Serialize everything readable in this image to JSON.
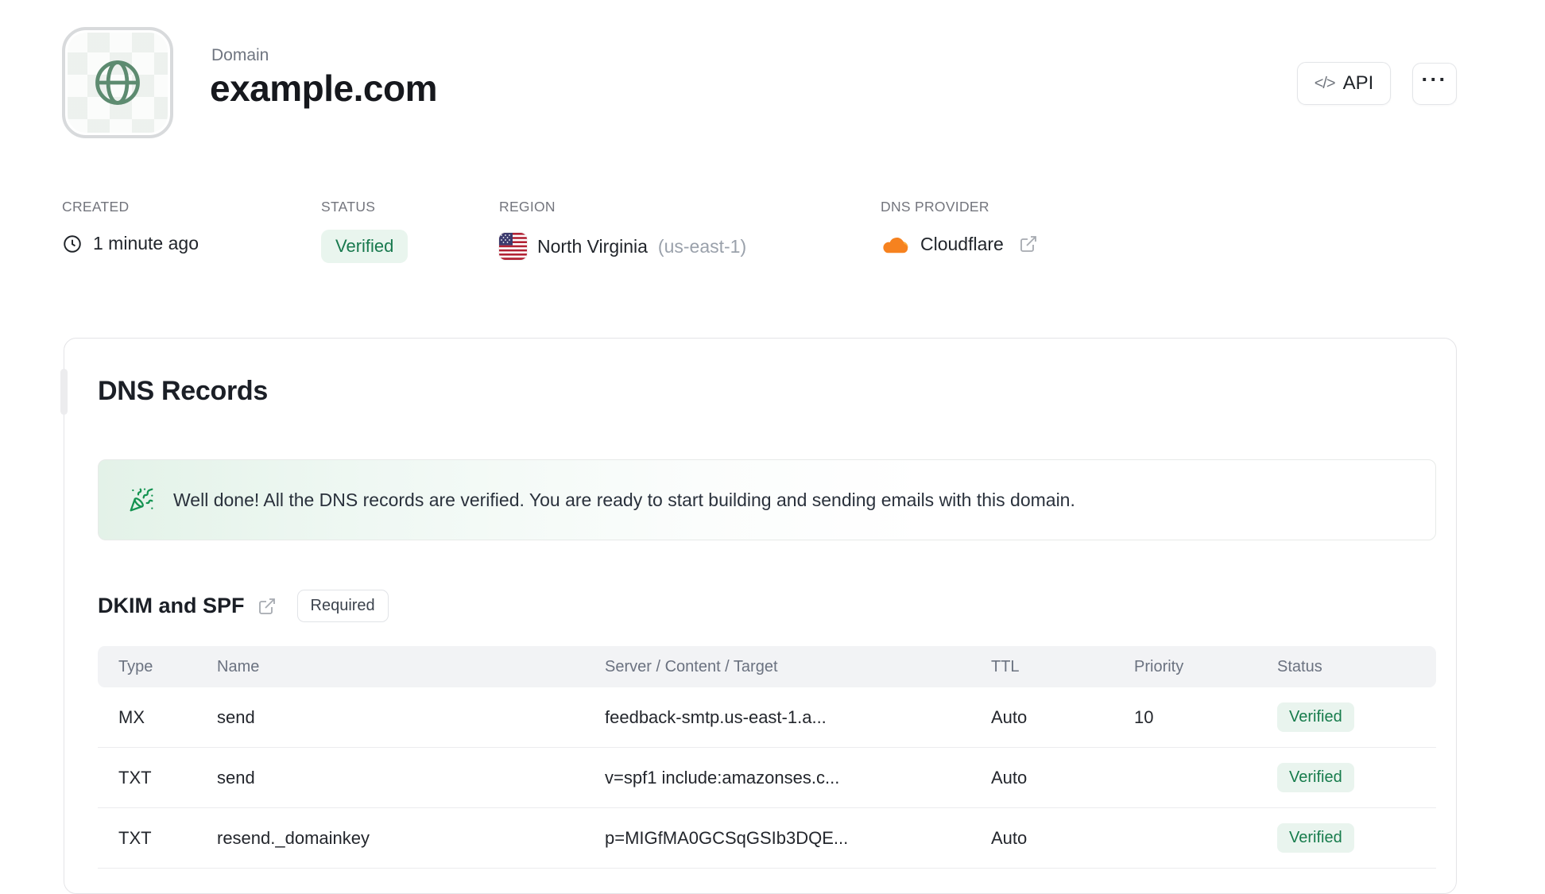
{
  "header": {
    "eyebrow": "Domain",
    "title": "example.com",
    "api_button_label": "API",
    "api_button_icon": "</>",
    "menu_button_label": "···"
  },
  "meta": {
    "created": {
      "label": "CREATED",
      "value": "1 minute ago"
    },
    "status": {
      "label": "STATUS",
      "value": "Verified"
    },
    "region": {
      "label": "REGION",
      "value": "North Virginia",
      "code": "(us-east-1)"
    },
    "dns_provider": {
      "label": "DNS PROVIDER",
      "value": "Cloudflare"
    }
  },
  "dns_card": {
    "title": "DNS Records",
    "banner_text": "Well done! All the DNS records are verified. You are ready to start building and sending emails with this domain.",
    "section": {
      "title": "DKIM and SPF",
      "badge": "Required"
    },
    "table": {
      "columns": [
        "Type",
        "Name",
        "Server / Content / Target",
        "TTL",
        "Priority",
        "Status"
      ],
      "rows": [
        {
          "type": "MX",
          "name": "send",
          "content": "feedback-smtp.us-east-1.a...",
          "ttl": "Auto",
          "priority": "10",
          "status": "Verified"
        },
        {
          "type": "TXT",
          "name": "send",
          "content": "v=spf1 include:amazonses.c...",
          "ttl": "Auto",
          "priority": "",
          "status": "Verified"
        },
        {
          "type": "TXT",
          "name": "resend._domainkey",
          "content": "p=MIGfMA0GCSqGSIb3DQE...",
          "ttl": "Auto",
          "priority": "",
          "status": "Verified"
        }
      ]
    }
  },
  "colors": {
    "accent_green": "#177c4c",
    "badge_green_bg": "#e9f4ee",
    "banner_green": "#e3f2e8",
    "cloudflare_orange": "#f6821f",
    "cloudflare_orange_light": "#fbad41",
    "globe_green": "#5d8b70",
    "flag_blue": "#3c3b6e",
    "flag_red": "#b22234"
  }
}
